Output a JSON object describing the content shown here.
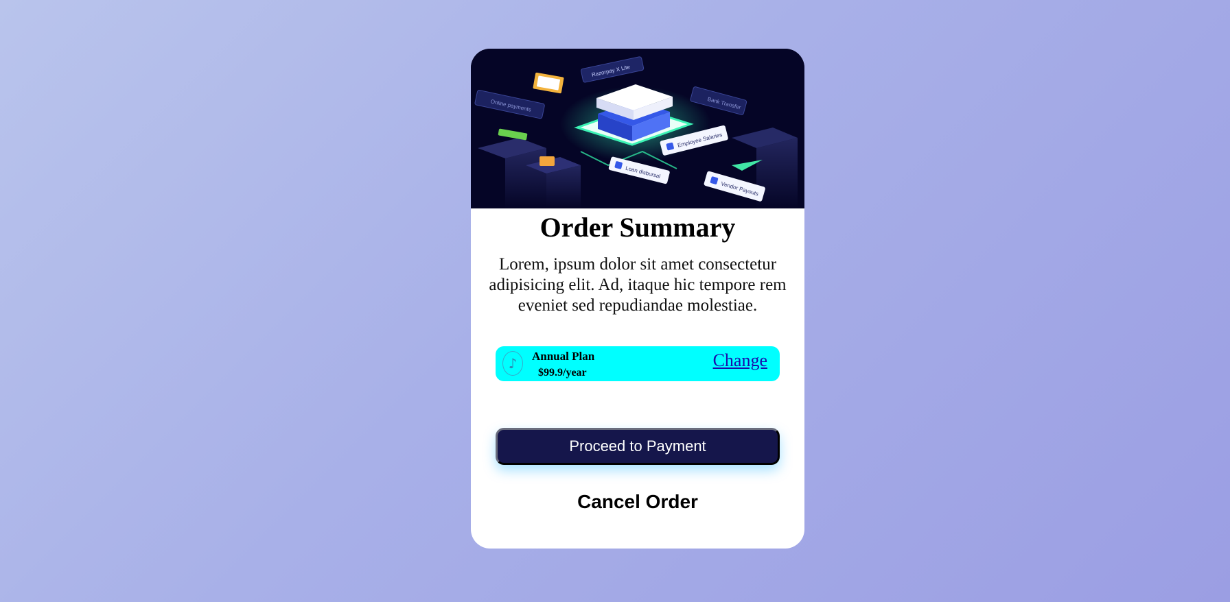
{
  "card": {
    "hero_labels": {
      "online_payments": "Online payments",
      "brand": "Razorpay X Lite",
      "bank_transfer": "Bank Transfer",
      "employee_salaries": "Employee Salaries",
      "loan_disbursal": "Loan disbursal",
      "vendor_payouts": "Vendor Payouts"
    },
    "title": "Order Summary",
    "description": "Lorem, ipsum dolor sit amet consectetur adipisicing elit. Ad, itaque hic tempore rem eveniet sed repudiandae molestiae.",
    "plan": {
      "icon": "music-note-icon",
      "name": "Annual Plan",
      "price": "$99.9/year",
      "change_label": "Change"
    },
    "proceed_label": "Proceed to Payment",
    "cancel_label": "Cancel Order"
  },
  "colors": {
    "plan_background": "#00ffff",
    "button_background": "#15164b",
    "hero_background": "#050526",
    "link": "#1a0dab"
  }
}
